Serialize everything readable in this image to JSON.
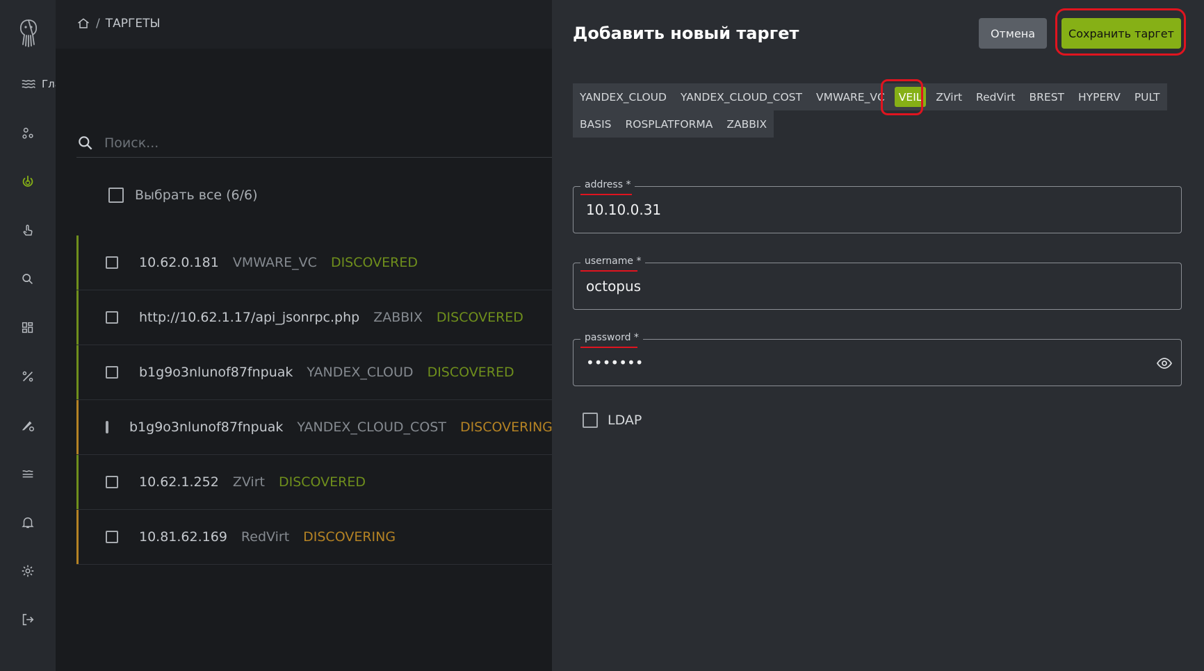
{
  "sidebar": {
    "home_label": "Главная",
    "icons": [
      "octopus-logo-icon",
      "home-waves-icon",
      "nodes-icon",
      "power-icon",
      "touch-icon",
      "search-icon",
      "dashboard-icon",
      "percent-icon",
      "pen-settings-icon",
      "layers-icon",
      "bell-icon",
      "gear-icon",
      "logout-icon"
    ],
    "active_color": "#86b016"
  },
  "breadcrumb": {
    "section": "ТАРГЕТЫ"
  },
  "search": {
    "placeholder": "Поиск..."
  },
  "select_all": {
    "label": "Выбрать все (6/6)"
  },
  "targets": [
    {
      "address": "10.62.0.181",
      "type": "VMWARE_VC",
      "status": "DISCOVERED"
    },
    {
      "address": "http://10.62.1.17/api_jsonrpc.php",
      "type": "ZABBIX",
      "status": "DISCOVERED"
    },
    {
      "address": "b1g9o3nlunof87fnpuak",
      "type": "YANDEX_CLOUD",
      "status": "DISCOVERED"
    },
    {
      "address": "b1g9o3nlunof87fnpuak",
      "type": "YANDEX_CLOUD_COST",
      "status": "DISCOVERING"
    },
    {
      "address": "10.62.1.252",
      "type": "ZVirt",
      "status": "DISCOVERED"
    },
    {
      "address": "10.81.62.169",
      "type": "RedVirt",
      "status": "DISCOVERING"
    }
  ],
  "status_colors": {
    "DISCOVERED": "#6f8f1c",
    "DISCOVERING": "#b58324"
  },
  "panel": {
    "title": "Добавить новый таргет",
    "cancel_label": "Отмена",
    "save_label": "Сохранить таргет",
    "tabs_row1": [
      "YANDEX_CLOUD",
      "YANDEX_CLOUD_COST",
      "VMWARE_VC",
      "VEIL",
      "ZVirt",
      "RedVirt",
      "BREST",
      "HYPERV",
      "PULT"
    ],
    "tabs_row2": [
      "BASIS",
      "ROSPLATFORMA",
      "ZABBIX"
    ],
    "active_tab": "VEIL",
    "fields": {
      "address": {
        "label": "address *",
        "value": "10.10.0.31"
      },
      "username": {
        "label": "username *",
        "value": "octopus"
      },
      "password": {
        "label": "password *",
        "value": "1234567"
      }
    },
    "ldap_label": "LDAP"
  },
  "highlight_color": "#e0141f"
}
